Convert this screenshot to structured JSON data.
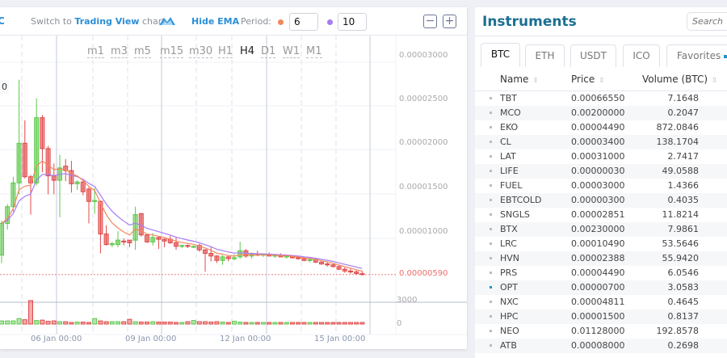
{
  "toolbar": {
    "left_fragment": "C",
    "switch_prefix": "Switch to ",
    "switch_link": "Trading View",
    "switch_suffix": " chart",
    "hide_ema": "Hide EMA",
    "period_label": "Period:",
    "ema_fast_period": "6",
    "ema_slow_period": "10",
    "ema_fast_color": "#f4875a",
    "ema_slow_color": "#a57cf6",
    "zoom_out": "−",
    "zoom_in": "+"
  },
  "chart": {
    "ohlc_fragment": "0",
    "timeframes": [
      "m1",
      "m3",
      "m5",
      "m15",
      "m30",
      "H1",
      "H4",
      "D1",
      "W1",
      "M1"
    ],
    "active_timeframe": "H4",
    "price_ticks": [
      "0.00003000",
      "0.00002500",
      "0.00002000",
      "0.00001500",
      "0.00001000"
    ],
    "last_price": "0.00000590",
    "volume_ticks": [
      "3000",
      "0"
    ],
    "date_labels": [
      "06 Jan 00:00",
      "09 Jan 00:00",
      "12 Jan 00:00",
      "15 Jan 00:00"
    ],
    "up_color": "#5cc84a",
    "down_color": "#e04848"
  },
  "chart_data": {
    "type": "candlestick",
    "price_range": [
      4e-06,
      3.1e-05
    ],
    "volume_range": [
      0,
      3000
    ],
    "candles": [
      [
        8.1e-06,
        1.2e-05,
        7.2e-06,
        1.17e-05
      ],
      [
        1.17e-05,
        1.39e-05,
        1.1e-05,
        1.36e-05
      ],
      [
        1.36e-05,
        1.7e-05,
        1.3e-05,
        1.63e-05
      ],
      [
        1.63e-05,
        2.8e-05,
        1.5e-05,
        2.08e-05
      ],
      [
        2.08e-05,
        2.34e-05,
        1.68e-05,
        1.7e-05
      ],
      [
        1.7e-05,
        1.72e-05,
        1.27e-05,
        1.63e-05
      ],
      [
        1.63e-05,
        2.59e-05,
        1.6e-05,
        2.37e-05
      ],
      [
        2.37e-05,
        2.4e-05,
        1.75e-05,
        2.02e-05
      ],
      [
        2.02e-05,
        2.05e-05,
        1.5e-05,
        1.71e-05
      ],
      [
        1.71e-05,
        1.85e-05,
        1.5e-05,
        1.66e-05
      ],
      [
        1.66e-05,
        1.95e-05,
        1.24e-05,
        1.8e-05
      ],
      [
        1.82e-05,
        1.9e-05,
        1.65e-05,
        1.77e-05
      ],
      [
        1.77e-05,
        1.88e-05,
        1.52e-05,
        1.62e-05
      ],
      [
        1.62e-05,
        1.66e-05,
        1.55e-05,
        1.64e-05
      ],
      [
        1.64e-05,
        1.66e-05,
        1.49e-05,
        1.53e-05
      ],
      [
        1.56e-05,
        1.58e-05,
        1.17e-05,
        1.42e-05
      ],
      [
        1.42e-05,
        1.57e-05,
        1.28e-05,
        1.43e-05
      ],
      [
        1.42e-05,
        1.43e-05,
        8.3e-06,
        1.05e-05
      ],
      [
        1.05e-05,
        1.15e-05,
        9.2e-06,
        9.3e-06
      ],
      [
        9.3e-06,
        9.6e-06,
        9e-06,
        9.4e-06
      ],
      [
        9.3e-06,
        1.08e-05,
        9e-06,
        9.8e-06
      ],
      [
        9.7e-06,
        1e-05,
        9.2e-06,
        9.6e-06
      ],
      [
        9.8e-06,
        9.8e-06,
        9e-06,
        9.5e-06
      ],
      [
        9.8e-06,
        1.36e-05,
        8.7e-06,
        1.27e-05
      ],
      [
        1.28e-05,
        1.29e-05,
        1.02e-05,
        1.04e-05
      ],
      [
        1.04e-05,
        1.05e-05,
        9.5e-06,
        9.6e-06
      ],
      [
        9.6e-06,
        1.06e-05,
        9.2e-06,
        1.01e-05
      ],
      [
        1.01e-05,
        1.02e-05,
        8.8e-06,
        9.9e-06
      ],
      [
        9.9e-06,
        1e-05,
        9e-06,
        9.7e-06
      ],
      [
        9.9e-06,
        1.03e-05,
        9.4e-06,
        9.5e-06
      ],
      [
        9.5e-06,
        1.01e-05,
        8.7e-06,
        9.1e-06
      ],
      [
        9.1e-06,
        9.3e-06,
        8.9e-06,
        9.2e-06
      ],
      [
        9.2e-06,
        9.3e-06,
        8.9e-06,
        9.1e-06
      ],
      [
        9.1e-06,
        9.2e-06,
        8.9e-06,
        9.1e-06
      ],
      [
        9.2e-06,
        9.4e-06,
        8.5e-06,
        8.7e-06
      ],
      [
        8.7e-06,
        8.8e-06,
        6.2e-06,
        8.3e-06
      ],
      [
        8.3e-06,
        9e-06,
        7.4e-06,
        8e-06
      ],
      [
        8e-06,
        8.1e-06,
        7.2e-06,
        7.5e-06
      ],
      [
        7.5e-06,
        8.1e-06,
        7e-06,
        7.9e-06
      ],
      [
        7.9e-06,
        8e-06,
        7.4e-06,
        7.7e-06
      ],
      [
        7.7e-06,
        8.2e-06,
        7.5e-06,
        7.8e-06
      ],
      [
        7.9e-06,
        9.6e-06,
        7.7e-06,
        8.6e-06
      ],
      [
        8.6e-06,
        8.8e-06,
        7.8e-06,
        8e-06
      ],
      [
        8e-06,
        8.4e-06,
        7.7e-06,
        8.2e-06
      ],
      [
        8.2e-06,
        8.6e-06,
        8e-06,
        8.1e-06
      ],
      [
        8.1e-06,
        8.3e-06,
        7.9e-06,
        8.2e-06
      ],
      [
        8.2e-06,
        8.4e-06,
        8e-06,
        8e-06
      ],
      [
        8e-06,
        8.2e-06,
        7.8e-06,
        8.1e-06
      ],
      [
        8.1e-06,
        8.3e-06,
        7.9e-06,
        7.9e-06
      ],
      [
        7.9e-06,
        8.1e-06,
        7.7e-06,
        8e-06
      ],
      [
        8e-06,
        8.1e-06,
        7.7e-06,
        7.8e-06
      ],
      [
        7.8e-06,
        8e-06,
        7.6e-06,
        7.7e-06
      ],
      [
        7.7e-06,
        7.9e-06,
        7.4e-06,
        7.5e-06
      ],
      [
        7.5e-06,
        7.8e-06,
        7.3e-06,
        7.6e-06
      ],
      [
        7.6e-06,
        7.7e-06,
        7.2e-06,
        7.3e-06
      ],
      [
        7.3e-06,
        7.5e-06,
        7e-06,
        7.1e-06
      ],
      [
        7.1e-06,
        7.3e-06,
        6.8e-06,
        7e-06
      ],
      [
        7e-06,
        7.2e-06,
        6.7e-06,
        6.8e-06
      ],
      [
        6.8e-06,
        7e-06,
        6.4e-06,
        6.5e-06
      ],
      [
        6.5e-06,
        6.7e-06,
        6.1e-06,
        6.3e-06
      ],
      [
        6.3e-06,
        6.6e-06,
        6e-06,
        6.2e-06
      ],
      [
        6.2e-06,
        6.4e-06,
        5.9e-06,
        6e-06
      ],
      [
        6e-06,
        6.3e-06,
        5.8e-06,
        5.9e-06
      ]
    ],
    "volumes": [
      300,
      300,
      300,
      600,
      450,
      2900,
      350,
      400,
      250,
      300,
      200,
      200,
      100,
      150,
      150,
      100,
      600,
      300,
      200,
      200,
      200,
      200,
      500,
      200,
      150,
      150,
      200,
      150,
      150,
      150,
      100,
      100,
      200,
      350,
      200,
      200,
      150,
      200,
      150,
      100,
      250,
      150,
      100,
      100,
      100,
      100,
      100,
      100,
      100,
      100,
      100,
      100,
      100,
      100,
      100,
      100,
      100,
      100,
      100,
      100,
      100,
      100,
      100
    ]
  },
  "instruments": {
    "title": "Instruments",
    "search_placeholder": "Search",
    "tabs": [
      "BTC",
      "ETH",
      "USDT",
      "ICO",
      "Favorites"
    ],
    "active_tab": "BTC",
    "columns": [
      "Name",
      "Price",
      "Volume (BTC)"
    ],
    "selected": "OPT",
    "rows": [
      {
        "name": "TBT",
        "price": "0.00066550",
        "volume": "7.1648"
      },
      {
        "name": "MCO",
        "price": "0.00200000",
        "volume": "0.2047"
      },
      {
        "name": "EKO",
        "price": "0.00004490",
        "volume": "872.0846"
      },
      {
        "name": "CL",
        "price": "0.00003400",
        "volume": "138.1704"
      },
      {
        "name": "LAT",
        "price": "0.00031000",
        "volume": "2.7417"
      },
      {
        "name": "LIFE",
        "price": "0.00000030",
        "volume": "49.0588"
      },
      {
        "name": "FUEL",
        "price": "0.00003000",
        "volume": "1.4366"
      },
      {
        "name": "EBTCOLD",
        "price": "0.00000300",
        "volume": "0.4035"
      },
      {
        "name": "SNGLS",
        "price": "0.00002851",
        "volume": "11.8214"
      },
      {
        "name": "BTX",
        "price": "0.00230000",
        "volume": "7.9861"
      },
      {
        "name": "LRC",
        "price": "0.00010490",
        "volume": "53.5646"
      },
      {
        "name": "HVN",
        "price": "0.00002388",
        "volume": "55.9420"
      },
      {
        "name": "PRS",
        "price": "0.00004490",
        "volume": "6.0546"
      },
      {
        "name": "OPT",
        "price": "0.00000700",
        "volume": "3.0583"
      },
      {
        "name": "NXC",
        "price": "0.00004811",
        "volume": "0.4645"
      },
      {
        "name": "HPC",
        "price": "0.00001500",
        "volume": "0.8137"
      },
      {
        "name": "NEO",
        "price": "0.01128000",
        "volume": "192.8578"
      },
      {
        "name": "ATB",
        "price": "0.00008000",
        "volume": "0.2698"
      }
    ]
  }
}
